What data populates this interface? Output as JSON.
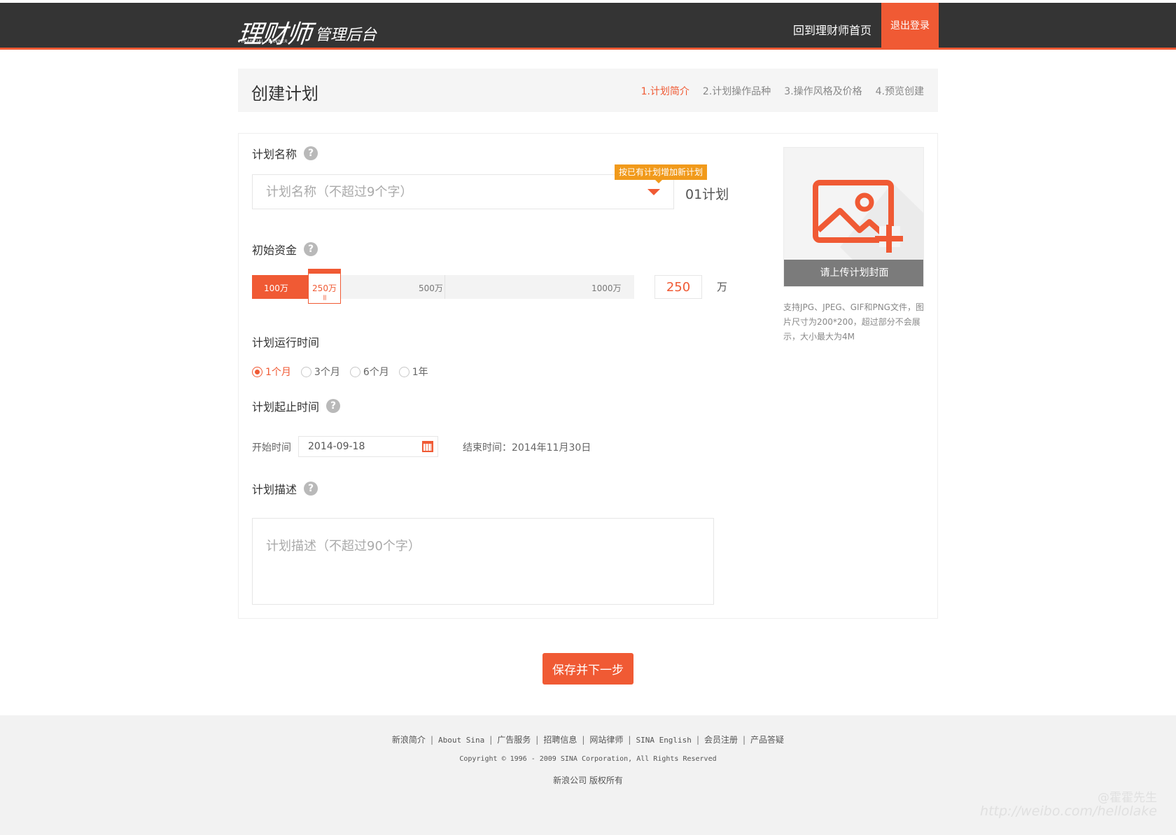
{
  "header": {
    "logo_brand": "理财师",
    "logo_sub": "FINANCIAL PLANNER",
    "logo_suffix": "管理后台",
    "home_link": "回到理财师首页",
    "logout": "退出登录"
  },
  "page": {
    "title": "创建计划",
    "steps": [
      "1.计划简介",
      "2.计划操作品种",
      "3.操作风格及价格",
      "4.预览创建"
    ],
    "active_step": 0
  },
  "form": {
    "name": {
      "label": "计划名称",
      "placeholder": "计划名称（不超过9个字）",
      "tooltip": "按已有计划增加新计划",
      "suffix": "01计划"
    },
    "capital": {
      "label": "初始资金",
      "ticks": [
        "100万",
        "500万",
        "1000万"
      ],
      "thumb_label": "250万",
      "value": "250",
      "unit": "万",
      "min": 100,
      "max": 1000,
      "current": 250
    },
    "duration": {
      "label": "计划运行时间",
      "options": [
        "1个月",
        "3个月",
        "6个月",
        "1年"
      ],
      "selected": 0
    },
    "period": {
      "label": "计划起止时间",
      "start_label": "开始时间",
      "start_value": "2014-09-18",
      "end_text": "结束时间：2014年11月30日"
    },
    "description": {
      "label": "计划描述",
      "placeholder": "计划描述（不超过90个字）"
    },
    "upload": {
      "button": "请上传计划封面",
      "note": "支持JPG、JPEG、GIF和PNG文件，图片尺寸为200*200，超过部分不会展示，大小最大为4M"
    },
    "submit": "保存并下一步"
  },
  "footer": {
    "links": [
      "新浪简介",
      "About Sina",
      "广告服务",
      "招聘信息",
      "网站律师",
      "SINA English",
      "会员注册",
      "产品答疑"
    ],
    "copyright": "Copyright © 1996 - 2009 SINA Corporation, All Rights Reserved",
    "rights": "新浪公司 版权所有"
  },
  "watermark": {
    "line1": "@霍霍先生",
    "line2": "http://weibo.com/hellolake"
  },
  "colors": {
    "accent": "#f05a34",
    "header_bg": "#343434",
    "tooltip": "#f19a1b"
  }
}
